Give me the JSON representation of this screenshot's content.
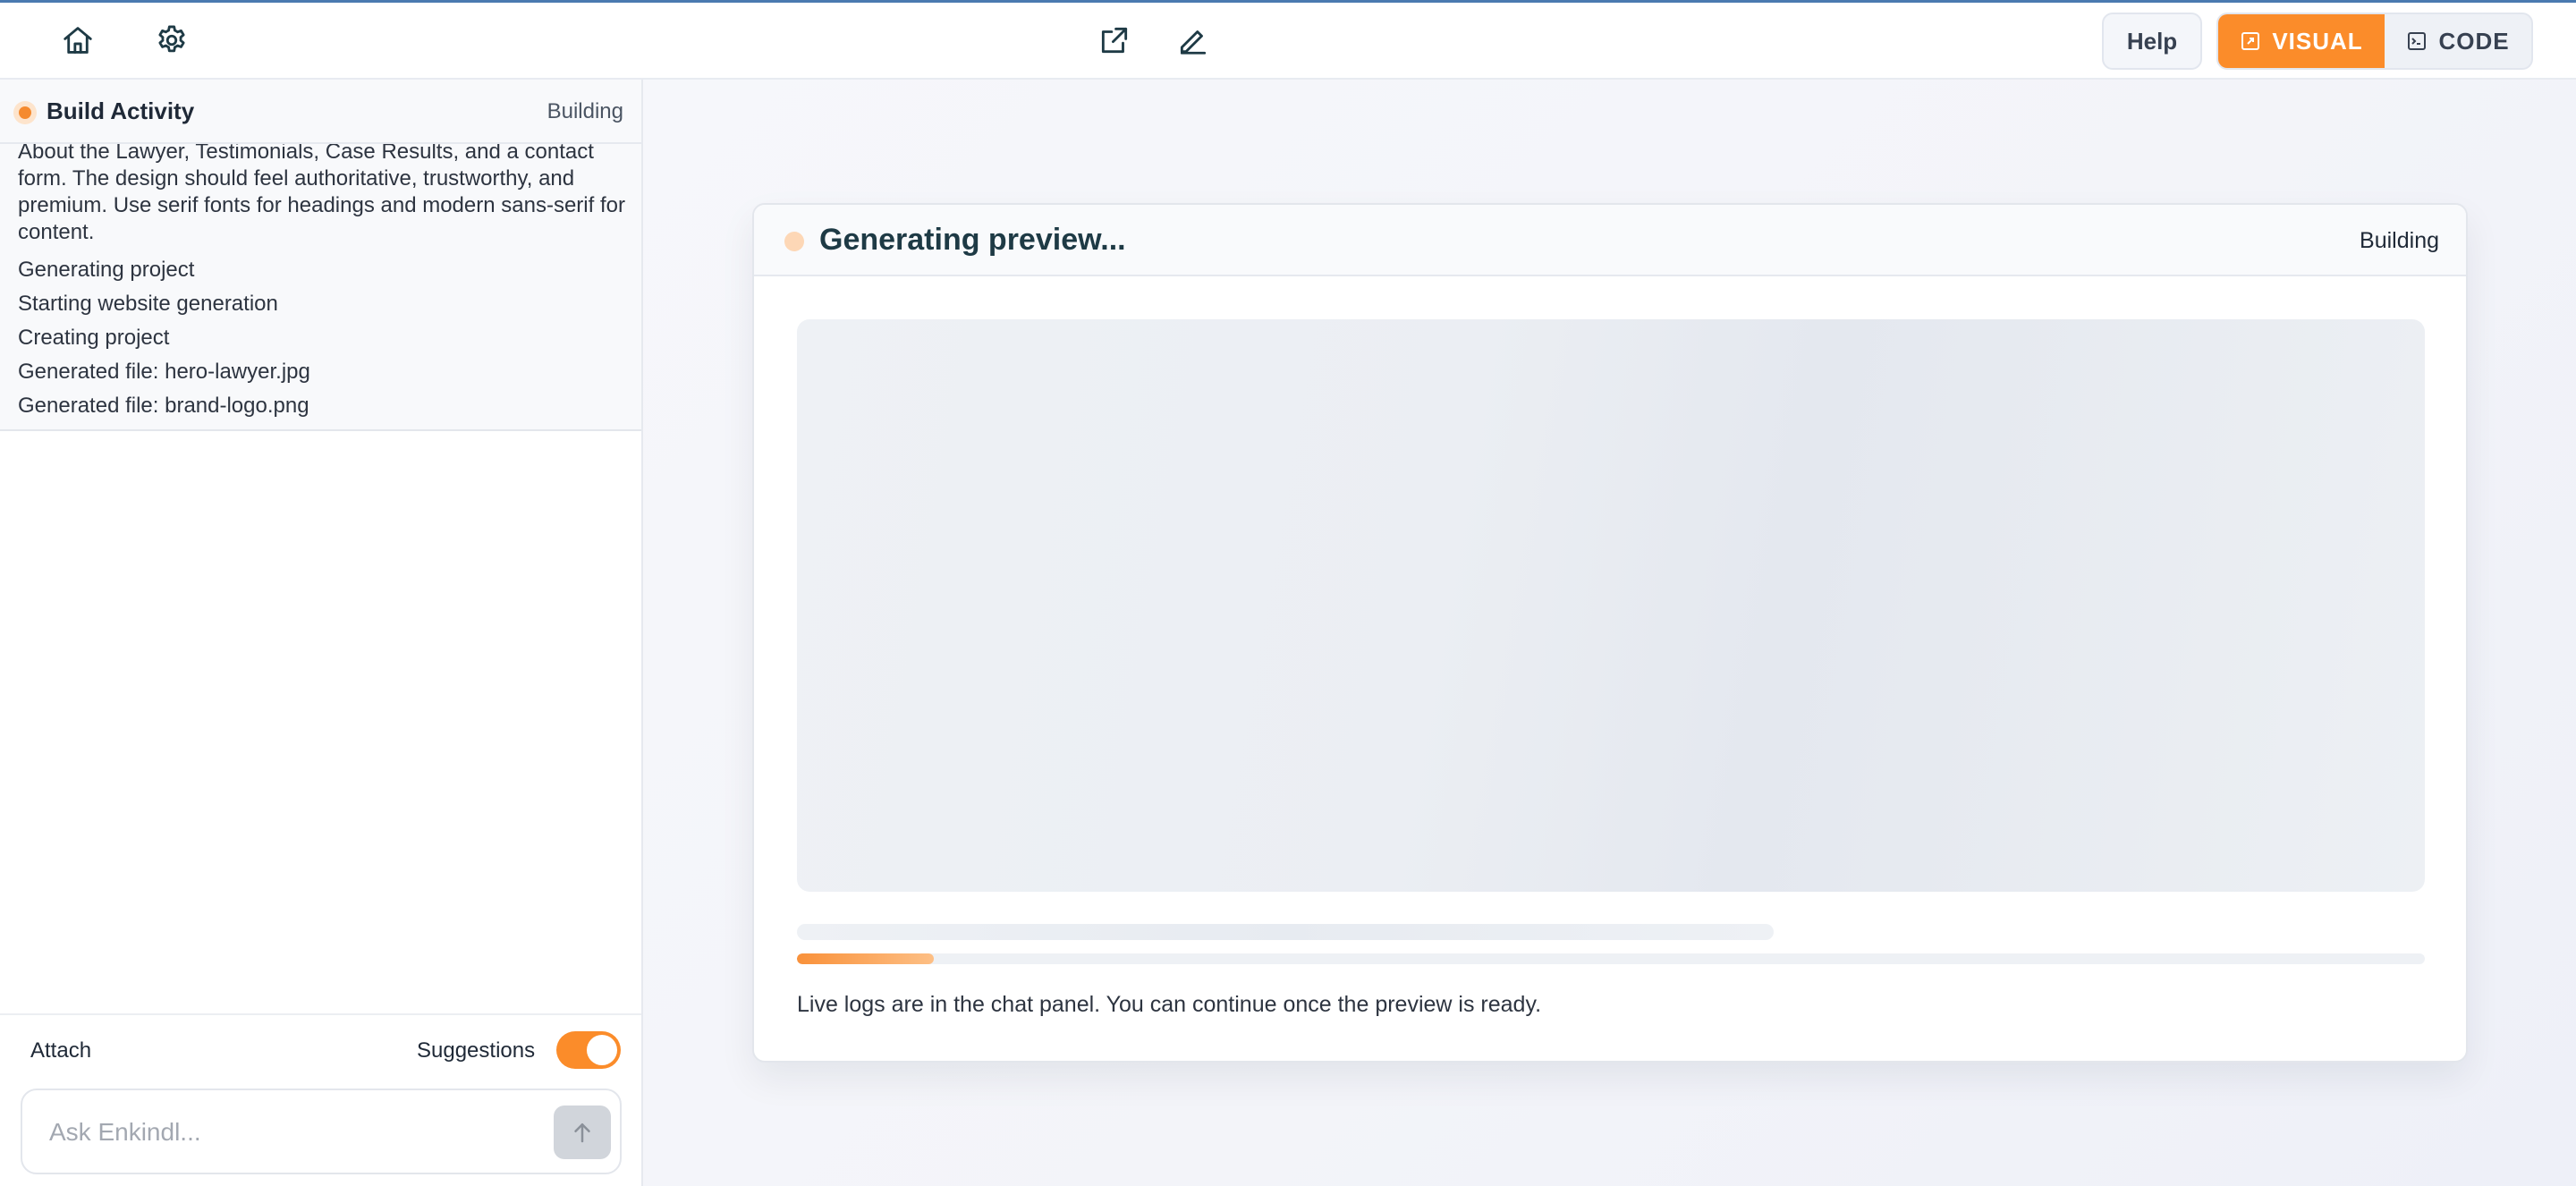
{
  "header": {
    "icons": {
      "home": "home-icon",
      "settings": "gear-icon",
      "open_external": "external-link-icon",
      "edit": "pencil-icon"
    },
    "help_label": "Help",
    "visual_label": "VISUAL",
    "code_label": "CODE"
  },
  "activity": {
    "title": "Build Activity",
    "status": "Building",
    "description": "About the Lawyer, Testimonials, Case Results, and a contact form. The design should feel authoritative, trustworthy, and premium. Use serif fonts for headings and modern sans-serif for content.",
    "lines": [
      "Generating project",
      "Starting website generation",
      "Creating project",
      "Generated file: hero-lawyer.jpg",
      "Generated file: brand-logo.png"
    ]
  },
  "composer": {
    "attach_label": "Attach",
    "suggestions_label": "Suggestions",
    "suggestions_enabled": true,
    "placeholder": "Ask Enkindl...",
    "value": ""
  },
  "preview": {
    "title": "Generating preview...",
    "status": "Building",
    "progress": 0.084,
    "note": "Live logs are in the chat panel. You can continue once the preview is ready."
  },
  "colors": {
    "accent": "#fb8c2a",
    "title_teal": "#1e3a45"
  }
}
